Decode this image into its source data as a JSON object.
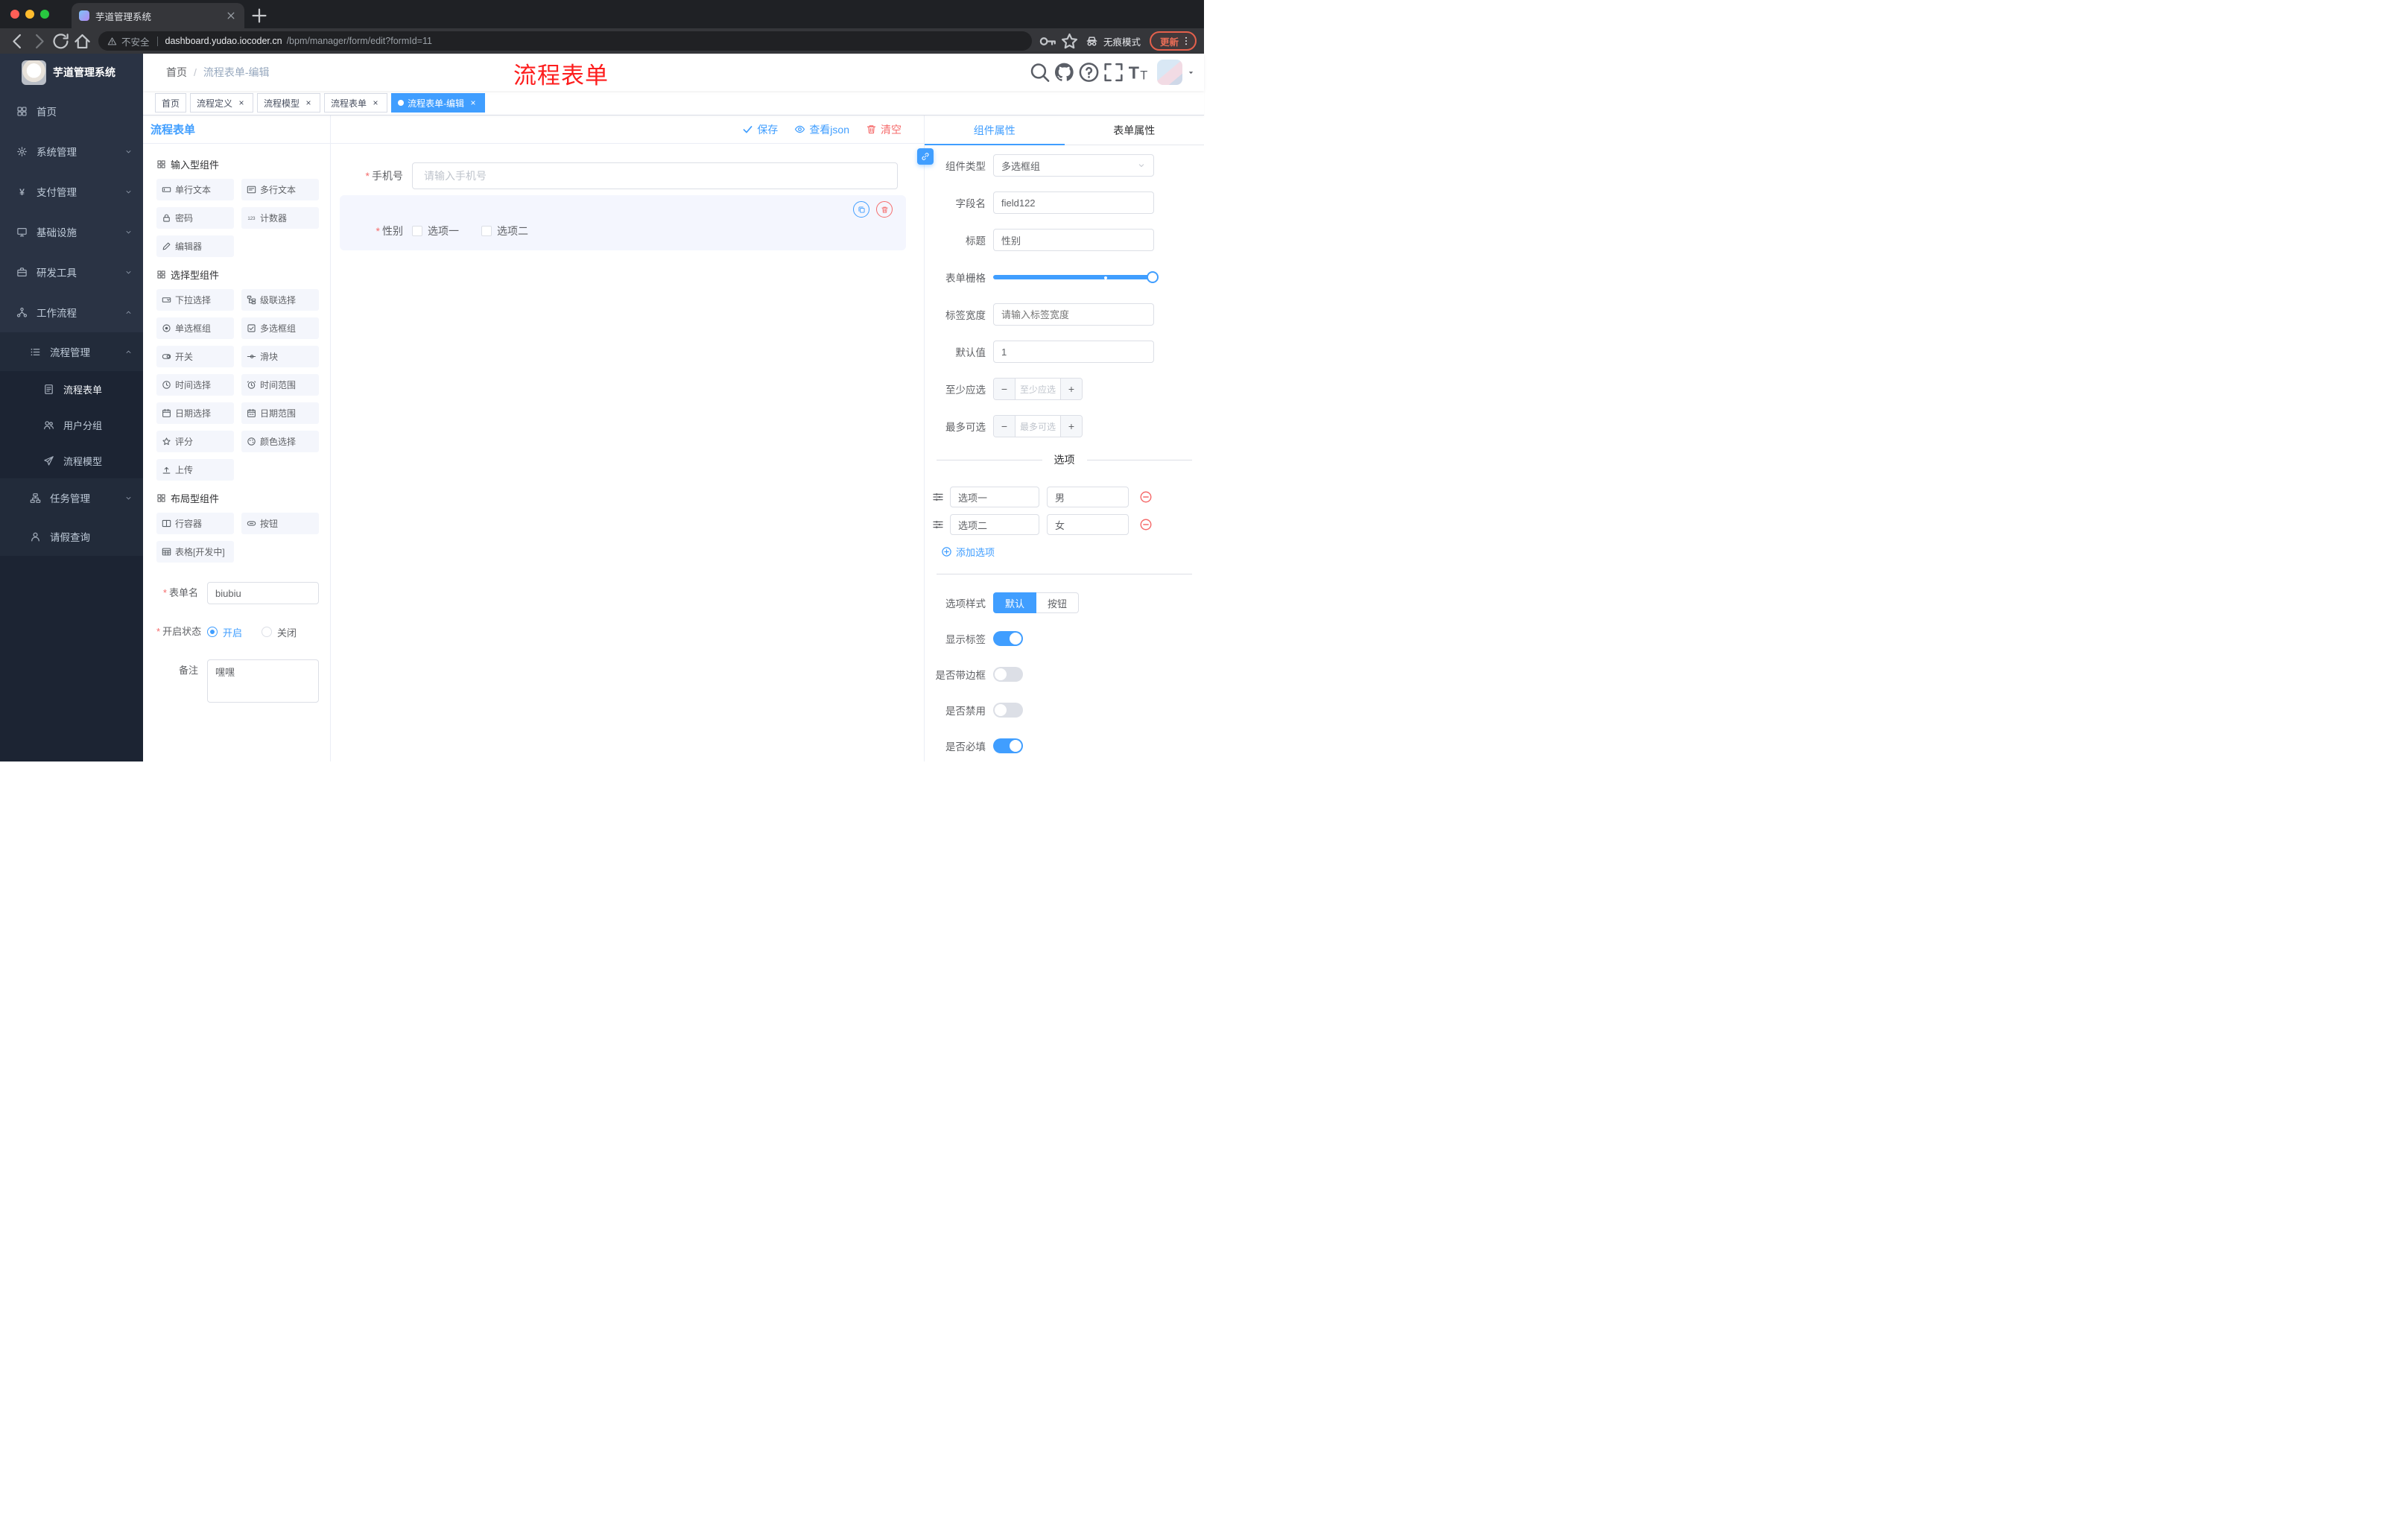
{
  "colors": {
    "accent": "#409eff",
    "danger": "#f56c6c",
    "annotation": "#fd1d1d",
    "sidebar_bg": "#2a3344"
  },
  "browser": {
    "tab": {
      "title": "芋道管理系统"
    },
    "address": {
      "security": "不安全",
      "url_host": "dashboard.yudao.iocoder.cn",
      "url_path": "/bpm/manager/form/edit?formId=11",
      "incognito": "无痕模式",
      "update": "更新"
    }
  },
  "sidebar": {
    "app_title": "芋道管理系统",
    "items": [
      {
        "key": "home",
        "label": "首页",
        "icon": "dash",
        "level": 1
      },
      {
        "key": "system",
        "label": "系统管理",
        "icon": "gear",
        "level": 1,
        "arrow": "down"
      },
      {
        "key": "payment",
        "label": "支付管理",
        "icon": "pay",
        "level": 1,
        "arrow": "down"
      },
      {
        "key": "infra",
        "label": "基础设施",
        "icon": "infra",
        "level": 1,
        "arrow": "down"
      },
      {
        "key": "devtools",
        "label": "研发工具",
        "icon": "tools",
        "level": 1,
        "arrow": "down"
      },
      {
        "key": "workflow",
        "label": "工作流程",
        "icon": "flow",
        "level": 1,
        "arrow": "up"
      },
      {
        "key": "process-mgmt",
        "label": "流程管理",
        "icon": "list",
        "level": 2,
        "arrow": "up"
      },
      {
        "key": "process-form",
        "label": "流程表单",
        "icon": "doc",
        "level": 3,
        "active": true
      },
      {
        "key": "user-group",
        "label": "用户分组",
        "icon": "users",
        "level": 3
      },
      {
        "key": "process-model",
        "label": "流程模型",
        "icon": "send",
        "level": 3
      },
      {
        "key": "task-mgmt",
        "label": "任务管理",
        "icon": "tree",
        "level": 2,
        "arrow": "down"
      },
      {
        "key": "leave-query",
        "label": "请假查询",
        "icon": "person",
        "level": 2
      }
    ]
  },
  "navbar": {
    "breadcrumb": [
      "首页",
      "流程表单-编辑"
    ],
    "overlay_title": "流程表单"
  },
  "tags": [
    {
      "key": "home",
      "label": "首页",
      "closable": false,
      "active": false
    },
    {
      "key": "process-definition",
      "label": "流程定义",
      "closable": true,
      "active": false
    },
    {
      "key": "process-model",
      "label": "流程模型",
      "closable": true,
      "active": false
    },
    {
      "key": "process-form",
      "label": "流程表单",
      "closable": true,
      "active": false
    },
    {
      "key": "process-form-edit",
      "label": "流程表单-编辑",
      "closable": true,
      "active": true
    }
  ],
  "editor": {
    "title": "流程表单",
    "actions": {
      "save": "保存",
      "view_json": "查看json",
      "clear": "清空"
    },
    "palette": {
      "sections": [
        {
          "title": "输入型组件",
          "items": [
            {
              "key": "single-line-text",
              "label": "单行文本",
              "icon": "input"
            },
            {
              "key": "multi-line-text",
              "label": "多行文本",
              "icon": "textarea"
            },
            {
              "key": "password",
              "label": "密码",
              "icon": "password"
            },
            {
              "key": "counter",
              "label": "计数器",
              "icon": "number"
            },
            {
              "key": "editor",
              "label": "编辑器",
              "icon": "editor"
            }
          ]
        },
        {
          "title": "选择型组件",
          "items": [
            {
              "key": "select",
              "label": "下拉选择",
              "icon": "select"
            },
            {
              "key": "cascader",
              "label": "级联选择",
              "icon": "cascader"
            },
            {
              "key": "radio-group",
              "label": "单选框组",
              "icon": "radio"
            },
            {
              "key": "checkbox-group",
              "label": "多选框组",
              "icon": "checkbox"
            },
            {
              "key": "switch",
              "label": "开关",
              "icon": "switch"
            },
            {
              "key": "slider",
              "label": "滑块",
              "icon": "slider"
            },
            {
              "key": "time-picker",
              "label": "时间选择",
              "icon": "time"
            },
            {
              "key": "time-range",
              "label": "时间范围",
              "icon": "timerange"
            },
            {
              "key": "date-picker",
              "label": "日期选择",
              "icon": "date"
            },
            {
              "key": "date-range",
              "label": "日期范围",
              "icon": "daterange"
            },
            {
              "key": "rate",
              "label": "评分",
              "icon": "rate"
            },
            {
              "key": "color-picker",
              "label": "颜色选择",
              "icon": "color"
            },
            {
              "key": "upload",
              "label": "上传",
              "icon": "upload"
            }
          ]
        },
        {
          "title": "布局型组件",
          "items": [
            {
              "key": "row-container",
              "label": "行容器",
              "icon": "row"
            },
            {
              "key": "button",
              "label": "按钮",
              "icon": "btn"
            },
            {
              "key": "table",
              "label": "表格[开发中]",
              "icon": "table"
            }
          ]
        }
      ],
      "form": {
        "name_label": "表单名",
        "name_value": "biubiu",
        "status_label": "开启状态",
        "status_options": [
          {
            "label": "开启",
            "checked": true
          },
          {
            "label": "关闭",
            "checked": false
          }
        ],
        "remark_label": "备注",
        "remark_value": "嘿嘿"
      }
    },
    "canvas": {
      "phone": {
        "label": "手机号",
        "required": true,
        "placeholder": "请输入手机号"
      },
      "gender": {
        "label": "性别",
        "required": true,
        "options": [
          "选项一",
          "选项二"
        ]
      }
    },
    "props_panel": {
      "tabs": [
        {
          "label": "组件属性",
          "active": true
        },
        {
          "label": "表单属性",
          "active": false
        }
      ],
      "fields": {
        "type_label": "组件类型",
        "type_value": "多选框组",
        "field_label": "字段名",
        "field_value": "field122",
        "title_label": "标题",
        "title_value": "性别",
        "grid_label": "表单栅格",
        "label_width_label": "标签宽度",
        "label_width_placeholder": "请输入标签宽度",
        "default_label": "默认值",
        "default_value": "1",
        "min_label": "至少应选",
        "min_placeholder": "至少应选",
        "max_label": "最多可选",
        "max_placeholder": "最多可选"
      },
      "options": {
        "divider": "选项",
        "rows": [
          {
            "label": "选项一",
            "value": "男"
          },
          {
            "label": "选项二",
            "value": "女"
          }
        ],
        "add": "添加选项"
      },
      "style": {
        "label": "选项样式",
        "buttons": [
          {
            "key": "default",
            "label": "默认",
            "active": true
          },
          {
            "key": "button",
            "label": "按钮",
            "active": false
          }
        ]
      },
      "switches": [
        {
          "key": "show-label",
          "label": "显示标签",
          "on": true
        },
        {
          "key": "border",
          "label": "是否带边框",
          "on": false
        },
        {
          "key": "disabled",
          "label": "是否禁用",
          "on": false
        },
        {
          "key": "required",
          "label": "是否必填",
          "on": true
        }
      ]
    }
  }
}
